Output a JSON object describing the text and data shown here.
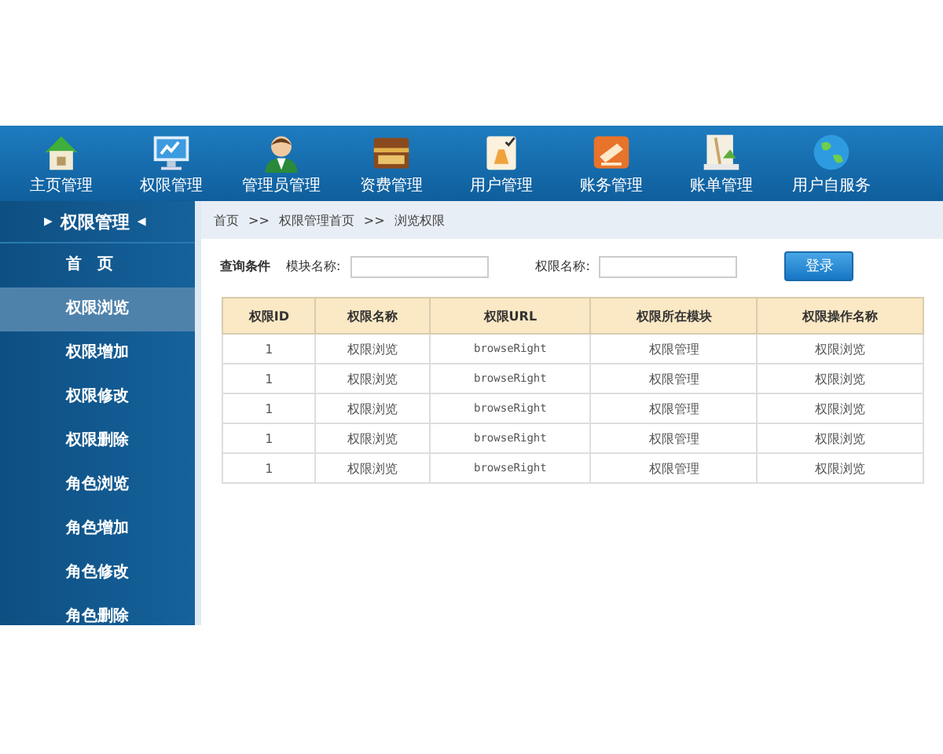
{
  "nav": [
    {
      "label": "主页管理"
    },
    {
      "label": "权限管理"
    },
    {
      "label": "管理员管理"
    },
    {
      "label": "资费管理"
    },
    {
      "label": "用户管理"
    },
    {
      "label": "账务管理"
    },
    {
      "label": "账单管理"
    },
    {
      "label": "用户自服务"
    }
  ],
  "sidebar": {
    "title_left": "▶",
    "title": "权限管理",
    "title_right": "◀",
    "items": [
      {
        "label": "首　页",
        "selected": false
      },
      {
        "label": "权限浏览",
        "selected": true
      },
      {
        "label": "权限增加",
        "selected": false
      },
      {
        "label": "权限修改",
        "selected": false
      },
      {
        "label": "权限删除",
        "selected": false
      },
      {
        "label": "角色浏览",
        "selected": false
      },
      {
        "label": "角色增加",
        "selected": false
      },
      {
        "label": "角色修改",
        "selected": false
      },
      {
        "label": "角色删除",
        "selected": false
      }
    ]
  },
  "breadcrumb": [
    "首页",
    "权限管理首页",
    "浏览权限"
  ],
  "breadcrumb_separator": ">>",
  "search": {
    "title": "查询条件",
    "fields": [
      {
        "label": "模块名称:"
      },
      {
        "label": "权限名称:"
      }
    ],
    "button": "登录"
  },
  "table": {
    "columns": [
      "权限ID",
      "权限名称",
      "权限URL",
      "权限所在模块",
      "权限操作名称"
    ],
    "rows": [
      [
        "1",
        "权限浏览",
        "browseRight",
        "权限管理",
        "权限浏览"
      ],
      [
        "1",
        "权限浏览",
        "browseRight",
        "权限管理",
        "权限浏览"
      ],
      [
        "1",
        "权限浏览",
        "browseRight",
        "权限管理",
        "权限浏览"
      ],
      [
        "1",
        "权限浏览",
        "browseRight",
        "权限管理",
        "权限浏览"
      ],
      [
        "1",
        "权限浏览",
        "browseRight",
        "权限管理",
        "权限浏览"
      ]
    ]
  }
}
